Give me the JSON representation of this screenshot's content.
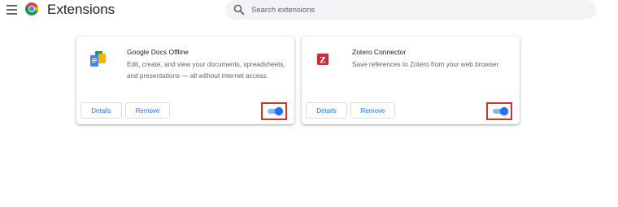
{
  "header": {
    "title": "Extensions",
    "menu_icon": "hamburger-menu-icon",
    "logo_icon": "chrome-logo-icon"
  },
  "search": {
    "placeholder": "Search extensions",
    "icon": "search-icon"
  },
  "extensions": [
    {
      "name": "Google Docs Offline",
      "description": "Edit, create, and view your documents, spreadsheets, and presentations — all without internet access.",
      "icon": "google-docs-offline-icon",
      "details_label": "Details",
      "remove_label": "Remove",
      "enabled": true
    },
    {
      "name": "Zotero Connector",
      "description": "Save references to Zotero from your web browser",
      "icon": "zotero-icon",
      "details_label": "Details",
      "remove_label": "Remove",
      "enabled": true
    }
  ],
  "colors": {
    "accent": "#1a73e8",
    "toggle_track": "#8ab4f8",
    "highlight_box": "#d93025",
    "search_bg": "#f1f3f4"
  }
}
